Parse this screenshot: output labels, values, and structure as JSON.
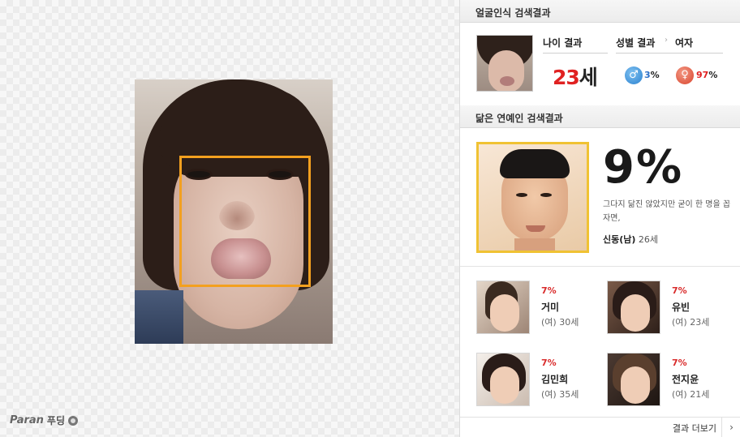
{
  "brand": {
    "name": "Paran",
    "sub": "푸딩"
  },
  "face_result": {
    "title": "얼굴인식 검색결과",
    "age_label": "나이 결과",
    "age_number": "23",
    "age_unit": "세",
    "gender_label": "성별 결과",
    "gender_result": "여자",
    "male_pct": "3",
    "female_pct": "97",
    "pct_sign": "%"
  },
  "celeb_result": {
    "title": "닮은 연예인 검색결과",
    "top": {
      "pct": "9%",
      "description": "그다지 닮진 않았지만 굳이 한 명을 꼽자면,",
      "name": "신동(남)",
      "age": "26세"
    },
    "others": [
      {
        "pct": "7%",
        "name": "거미",
        "info": "(여) 30세"
      },
      {
        "pct": "7%",
        "name": "유빈",
        "info": "(여) 23세"
      },
      {
        "pct": "7%",
        "name": "김민희",
        "info": "(여) 35세"
      },
      {
        "pct": "7%",
        "name": "전지윤",
        "info": "(여) 21세"
      }
    ]
  },
  "footer": {
    "more_label": "결과 더보기",
    "arrow": "›"
  },
  "colors": {
    "accent_red": "#e02222",
    "face_box": "#f3a01f",
    "highlight_border": "#f0c233"
  },
  "icons": {
    "male": "male-symbol",
    "female": "female-symbol"
  }
}
